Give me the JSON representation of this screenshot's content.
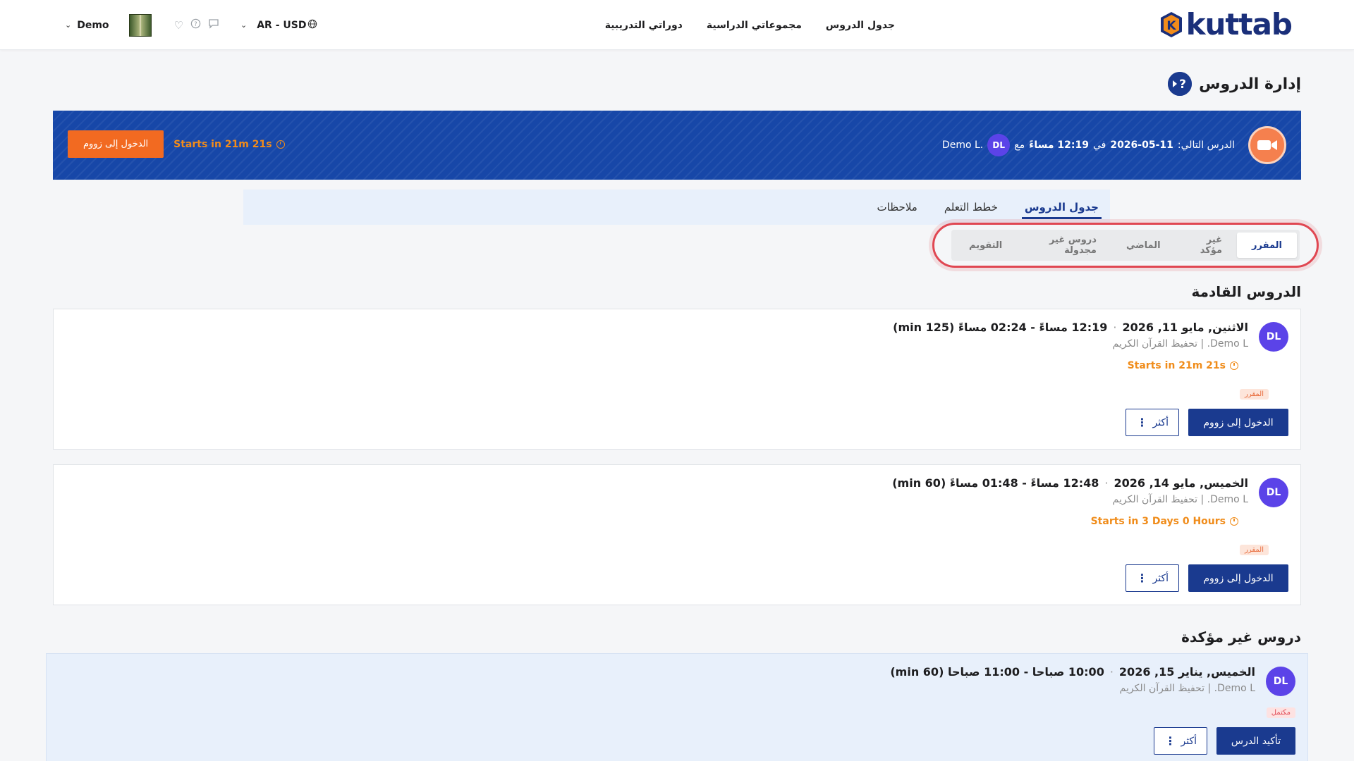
{
  "header": {
    "brand": "kuttab",
    "nav": [
      "جدول الدروس",
      "مجموعاتي الدراسية",
      "دوراتي التدريبية"
    ],
    "user_name": "Demo",
    "language_currency": "AR - USD"
  },
  "page": {
    "title": "إدارة الدروس"
  },
  "banner": {
    "label": "الدرس التالي:",
    "date": "2026-05-11",
    "at": "في",
    "time": "12:19 مساءً",
    "with": "مع",
    "avatar_initials": "DL",
    "teacher": "Demo L.",
    "starts": "Starts in 21m 21s",
    "join_button": "الدخول إلى زووم"
  },
  "main_tabs": [
    "جدول الدروس",
    "خطط التعلم",
    "ملاحظات"
  ],
  "sub_tabs": [
    "المقرر",
    "غير مؤكد",
    "الماضي",
    "دروس غير مجدولة",
    "التقويم"
  ],
  "sections": {
    "upcoming_title": "الدروس القادمة",
    "unconfirmed_title": "دروس غير مؤكدة"
  },
  "lessons": [
    {
      "initials": "DL",
      "date": "الاثنين, مايو 11, 2026",
      "time": "12:19 مساءً - 02:24 مساءً (125 min)",
      "subtitle": "Demo L. | تحفيظ القرآن الكريم",
      "starts": "Starts in 21m 21s",
      "status": "المقرر",
      "primary_button": "الدخول إلى زووم",
      "more_button": "أكثر"
    },
    {
      "initials": "DL",
      "date": "الخميس, مايو 14, 2026",
      "time": "12:48 مساءً - 01:48 مساءً (60 min)",
      "subtitle": "Demo L. | تحفيظ القرآن الكريم",
      "starts": "Starts in 3 Days 0 Hours",
      "status": "المقرر",
      "primary_button": "الدخول إلى زووم",
      "more_button": "أكثر"
    },
    {
      "initials": "DL",
      "date": "الخميس, يناير 15, 2026",
      "time": "10:00 صباحا - 11:00 صباحا (60 min)",
      "subtitle": "Demo L. | تحفيظ القرآن الكريم",
      "status": "مكتمل",
      "primary_button": "تأكيد الدرس",
      "more_button": "أكثر"
    }
  ],
  "colors": {
    "brand_blue": "#1a3a8f",
    "banner_blue": "#1747a8",
    "accent_orange": "#f26a21",
    "avatar_purple": "#5b43e8",
    "highlight_red": "#e04752"
  },
  "icons": [
    "logo-k-icon",
    "chevron-down-icon",
    "heart-icon",
    "help-circle-icon",
    "chat-icon",
    "globe-icon",
    "video-camera-icon",
    "clock-icon",
    "more-vertical-icon"
  ]
}
